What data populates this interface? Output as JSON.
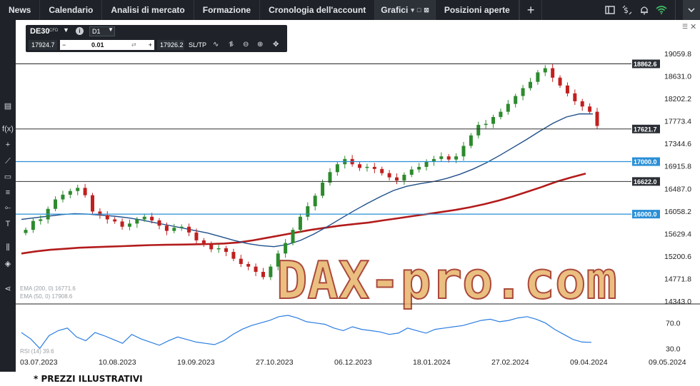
{
  "nav": {
    "tabs": [
      "News",
      "Calendario",
      "Analisi di mercato",
      "Formazione",
      "Cronologia dell'account"
    ],
    "active_tab": "Grafici",
    "after_tab": "Posizioni aperte",
    "plus": "+"
  },
  "instrument": {
    "symbol": "DE30",
    "type": "CFD",
    "timeframe": "D1",
    "bid": "17924.7",
    "ask": "17926.2",
    "quantity": "0.01",
    "sltp": "SL/TP",
    "minus": "−",
    "plus": "+",
    "info": "i",
    "chevron": "▼",
    "recycle": "⇄",
    "icons": [
      "line-chart-icon",
      "cursor-icon",
      "zoom-out-icon",
      "zoom-in-icon",
      "crosshair-icon"
    ],
    "icon_glyphs": [
      "∿",
      "⥮",
      "⊖",
      "⊕",
      "✥"
    ]
  },
  "left_toolbar": {
    "icons": [
      "panel-icon",
      "function-icon",
      "plus-icon",
      "trendline-icon",
      "rectangle-icon",
      "fibonacci-icon",
      "pitchfork-icon",
      "text-icon",
      "compare-icon",
      "layers-icon",
      "share-icon"
    ],
    "glyphs": [
      "▤",
      "f(x)",
      "+",
      "⟋",
      "▭",
      "≡",
      "⟜",
      "T",
      "⫼",
      "◈",
      "⋖"
    ]
  },
  "colors": {
    "ema50": "#1f4f8a",
    "ema200": "#b31b1b",
    "rsi": "#2a7de1",
    "up": "#2d8a2d",
    "down": "#c0201f",
    "highlight_level": "#2a8fd6",
    "dark_level": "#333333",
    "watermark_fill": "#e7b46a",
    "watermark_stroke": "#9c2a1a"
  },
  "levels": [
    {
      "value": 18862.6,
      "label": "18862.6",
      "style": "dark"
    },
    {
      "value": 17621.7,
      "label": "17621.7",
      "style": "dark"
    },
    {
      "value": 17000.0,
      "label": "17000.0",
      "style": "blue"
    },
    {
      "value": 16622.0,
      "label": "16622.0",
      "style": "dark"
    },
    {
      "value": 16000.0,
      "label": "16000.0",
      "style": "blue"
    }
  ],
  "legend": {
    "ema200": "EMA (200, 0) 16771.6",
    "ema50": "EMA (50, 0) 17908.6",
    "rsi": "RSI (14) 39.6"
  },
  "watermark": "DAX-pro.com",
  "window_icons": {
    "menu": "☰",
    "close": "✕"
  },
  "footer_note": "* PREZZI ILLUSTRATIVI",
  "chart_data": {
    "type": "candlestick",
    "symbol": "DE30",
    "timeframe": "D1",
    "x_ticks": [
      "03.07.2023",
      "10.08.2023",
      "19.09.2023",
      "27.10.2023",
      "06.12.2023",
      "18.01.2024",
      "27.02.2024",
      "09.04.2024",
      "09.05.2024"
    ],
    "y_ticks": [
      19059.8,
      18631.0,
      18202.2,
      17773.4,
      17344.6,
      16915.8,
      16487.0,
      16058.2,
      15629.4,
      15200.6,
      14771.8,
      14343.0
    ],
    "ylim": [
      14343.0,
      19059.8
    ],
    "close_series": [
      15700,
      15870,
      15900,
      16100,
      16280,
      16370,
      16440,
      16500,
      16360,
      16050,
      15980,
      15900,
      15860,
      15760,
      15820,
      15900,
      15950,
      15880,
      15780,
      15680,
      15740,
      15760,
      15650,
      15500,
      15420,
      15330,
      15350,
      15280,
      15150,
      15050,
      15000,
      14900,
      14800,
      15000,
      15250,
      15450,
      15700,
      15950,
      16150,
      16350,
      16600,
      16800,
      16950,
      17050,
      16950,
      16880,
      16900,
      16860,
      16780,
      16700,
      16640,
      16750,
      16850,
      16900,
      17000,
      17050,
      17100,
      17040,
      17100,
      17300,
      17500,
      17700,
      17720,
      17850,
      17950,
      18100,
      18250,
      18400,
      18520,
      18700,
      18780,
      18600,
      18450,
      18300,
      18150,
      18050,
      17950,
      17680
    ],
    "ema50": [
      15900,
      15930,
      15960,
      15990,
      16010,
      16000,
      15980,
      15960,
      15930,
      15890,
      15840,
      15790,
      15740,
      15690,
      15640,
      15570,
      15500,
      15440,
      15400,
      15380,
      15420,
      15500,
      15620,
      15760,
      15910,
      16060,
      16200,
      16330,
      16450,
      16530,
      16580,
      16620,
      16680,
      16760,
      16860,
      16980,
      17120,
      17270,
      17420,
      17580,
      17730,
      17850,
      17910,
      17908.6
    ],
    "ema200": [
      15250,
      15290,
      15320,
      15340,
      15360,
      15370,
      15380,
      15390,
      15400,
      15410,
      15415,
      15420,
      15425,
      15430,
      15440,
      15460,
      15500,
      15550,
      15600,
      15650,
      15700,
      15740,
      15780,
      15810,
      15840,
      15880,
      15920,
      15960,
      16000,
      16040,
      16080,
      16130,
      16190,
      16260,
      16340,
      16430,
      16520,
      16620,
      16700,
      16771.6
    ],
    "rsi": {
      "label": "RSI (14) 39.6",
      "ticks": [
        70.0,
        30.0
      ],
      "values": [
        55,
        45,
        30,
        50,
        58,
        62,
        48,
        42,
        55,
        50,
        44,
        38,
        52,
        45,
        40,
        35,
        42,
        48,
        44,
        40,
        38,
        36,
        42,
        52,
        60,
        66,
        70,
        74,
        80,
        82,
        78,
        72,
        70,
        68,
        62,
        58,
        64,
        60,
        58,
        56,
        52,
        54,
        62,
        58,
        54,
        60,
        62,
        64,
        66,
        70,
        74,
        76,
        72,
        74,
        78,
        80,
        76,
        70,
        60,
        52,
        44,
        40,
        39.6
      ]
    }
  }
}
